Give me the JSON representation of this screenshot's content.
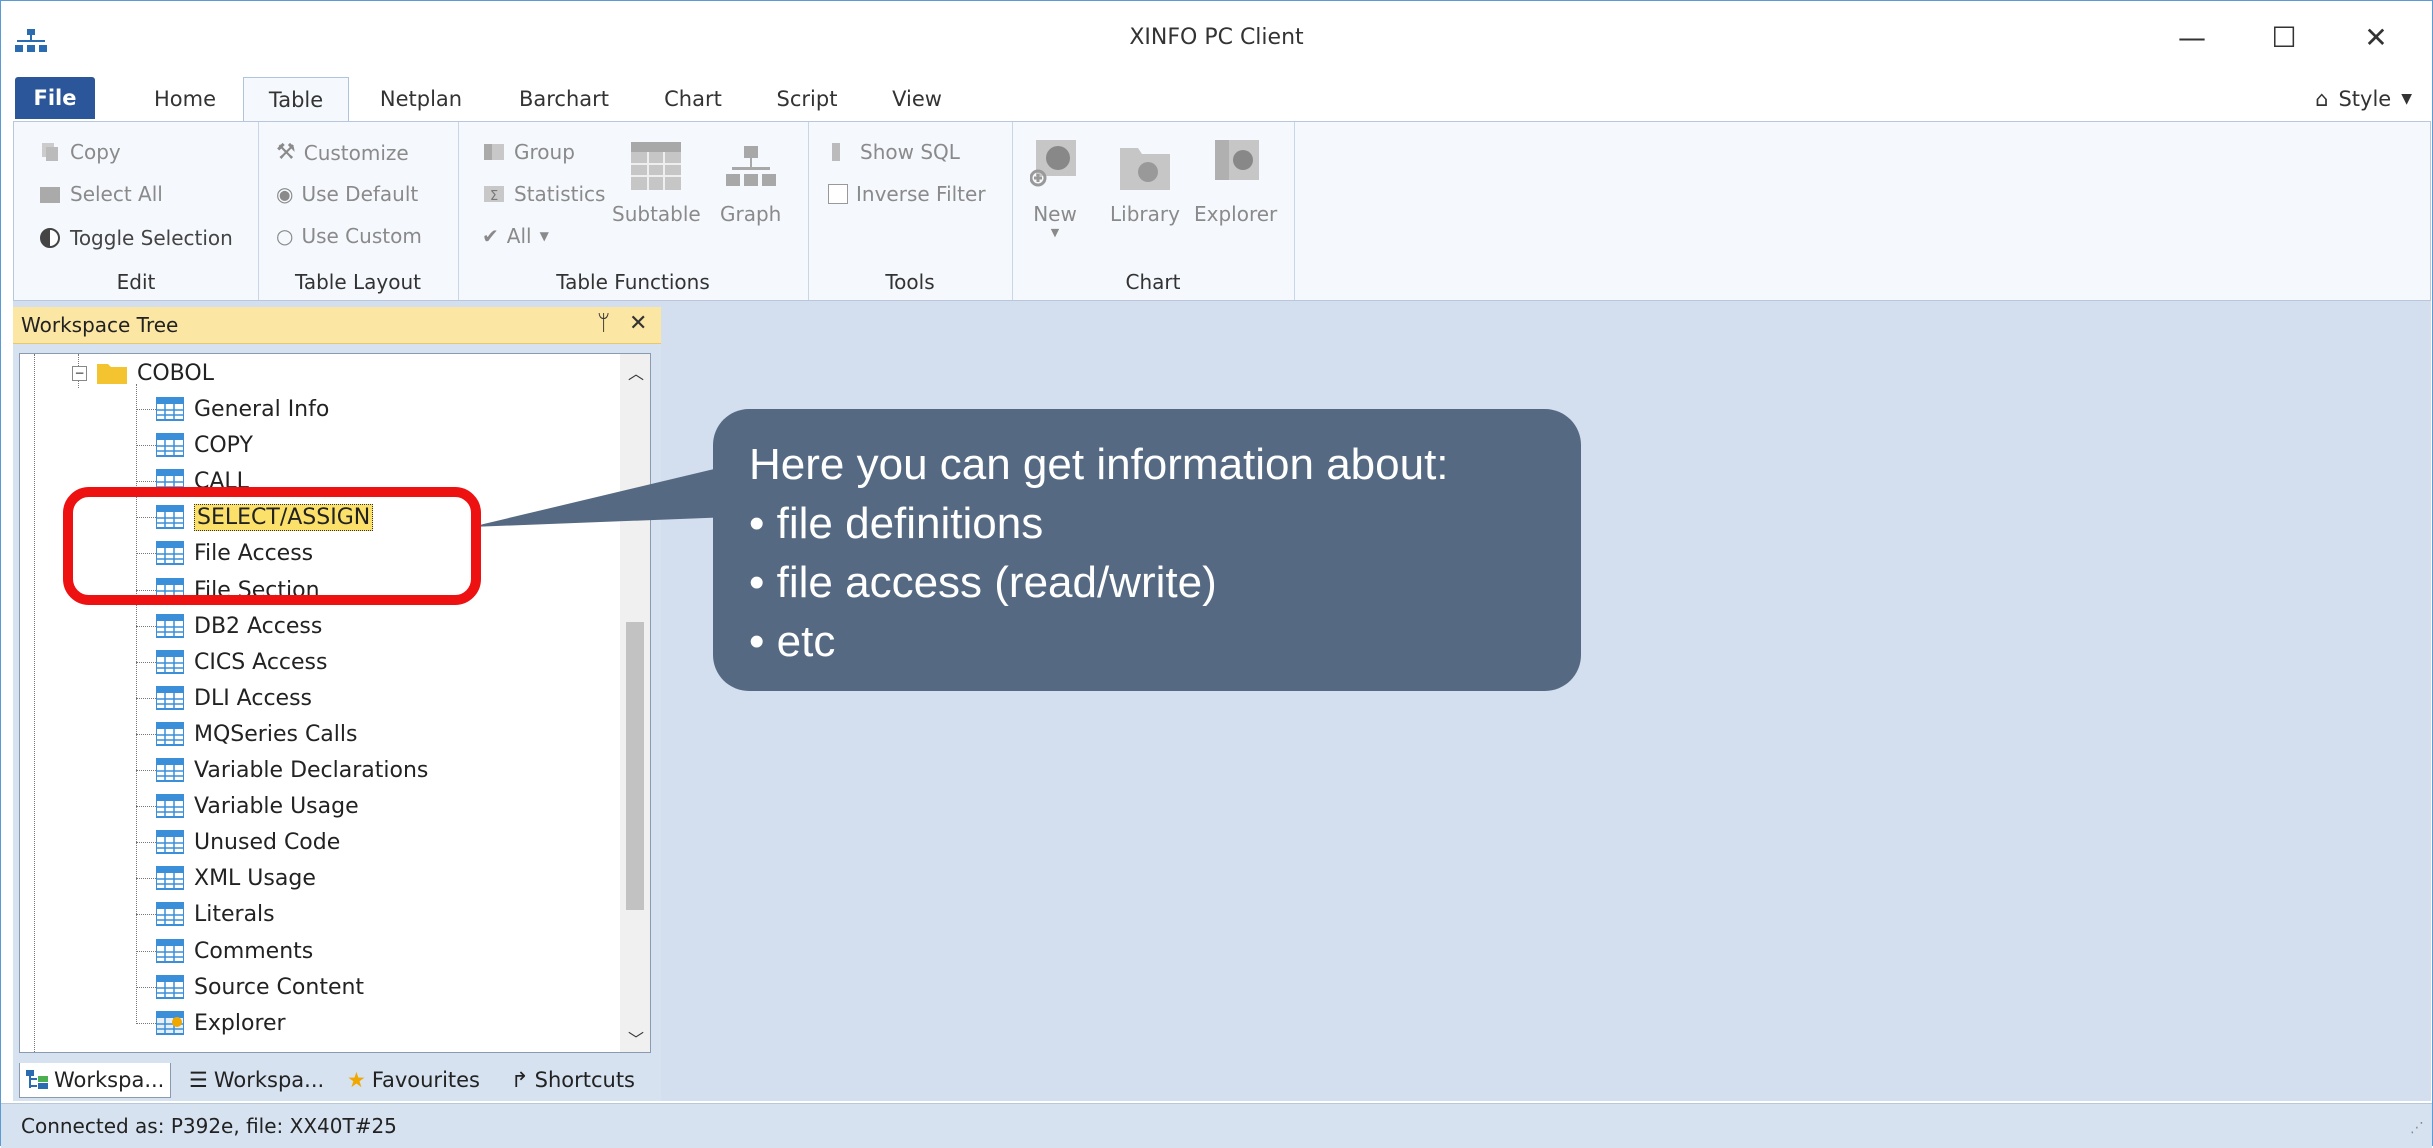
{
  "window": {
    "title": "XINFO PC Client",
    "minimize": "—",
    "maximize": "☐",
    "close": "✕"
  },
  "menu": {
    "tabs": [
      "File",
      "Home",
      "Table",
      "Netplan",
      "Barchart",
      "Chart",
      "Script",
      "View"
    ],
    "active_tab": "Table",
    "style_label": "Style"
  },
  "ribbon": {
    "edit": {
      "label": "Edit",
      "copy": "Copy",
      "select_all": "Select All",
      "toggle_selection": "Toggle Selection"
    },
    "table_layout": {
      "label": "Table Layout",
      "customize": "Customize",
      "use_default": "Use Default",
      "use_custom": "Use Custom"
    },
    "table_functions": {
      "label": "Table Functions",
      "group": "Group",
      "statistics": "Statistics",
      "all": "All",
      "subtable": "Subtable",
      "graph": "Graph"
    },
    "tools": {
      "label": "Tools",
      "show_sql": "Show SQL",
      "inverse_filter": "Inverse Filter"
    },
    "chart": {
      "label": "Chart",
      "new": "New",
      "library": "Library",
      "explorer": "Explorer"
    }
  },
  "workspace_tree": {
    "title": "Workspace Tree",
    "pin": "ᛘ",
    "close": "✕",
    "root": "COBOL",
    "items": [
      "General Info",
      "COPY",
      "CALL",
      "SELECT/ASSIGN",
      "File Access",
      "File Section",
      "DB2 Access",
      "CICS Access",
      "DLI Access",
      "MQSeries Calls",
      "Variable Declarations",
      "Variable Usage",
      "Unused Code",
      "XML Usage",
      "Literals",
      "Comments",
      "Source Content",
      "Explorer"
    ],
    "selected": "SELECT/ASSIGN"
  },
  "panel_tabs": [
    "Workspa...",
    "Workspa...",
    "Favourites",
    "Shortcuts"
  ],
  "status": {
    "text": "Connected as: P392e, file: XX40T#25"
  },
  "callout": {
    "heading": "Here you can get information about:",
    "bullets": [
      "• file definitions",
      "• file access (read/write)",
      "• etc"
    ]
  },
  "colors": {
    "file_tab": "#2b579a",
    "callout_bg": "#556a82",
    "highlight": "#ee1111",
    "panel_header": "#fbe6a4",
    "workspace_bg": "#d3dfee"
  }
}
